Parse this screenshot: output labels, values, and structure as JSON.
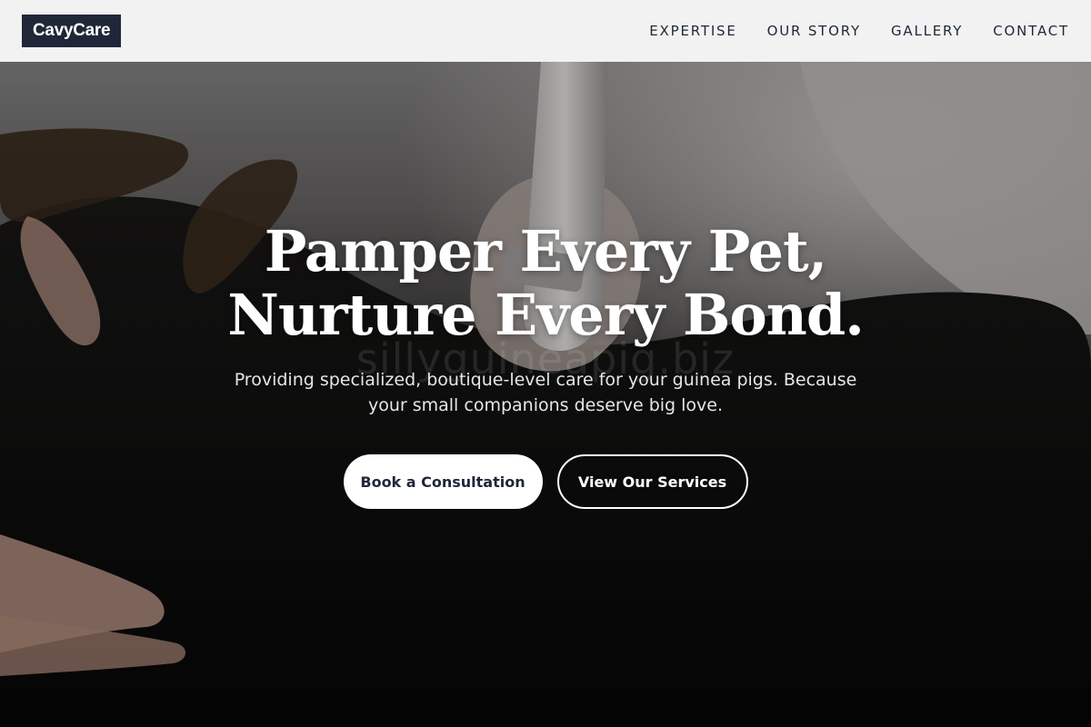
{
  "header": {
    "logo_text": "CavyCare",
    "nav": [
      {
        "label": "EXPERTISE"
      },
      {
        "label": "OUR STORY"
      },
      {
        "label": "GALLERY"
      },
      {
        "label": "CONTACT"
      }
    ]
  },
  "hero": {
    "headline_line1": "Pamper Every Pet,",
    "headline_line2": "Nurture Every Bond.",
    "subtitle": "Providing specialized, boutique-level care for your guinea pigs. Because your small companions deserve big love.",
    "primary_cta": "Book a Consultation",
    "secondary_cta": "View Our Services",
    "watermark": "sillyguineapig.biz",
    "image_subject": "veterinarian hands with clipper grooming a dark pet"
  },
  "colors": {
    "brand_dark": "#1f2738",
    "header_bg": "#f2f2f2",
    "button_light": "#ffffff"
  }
}
